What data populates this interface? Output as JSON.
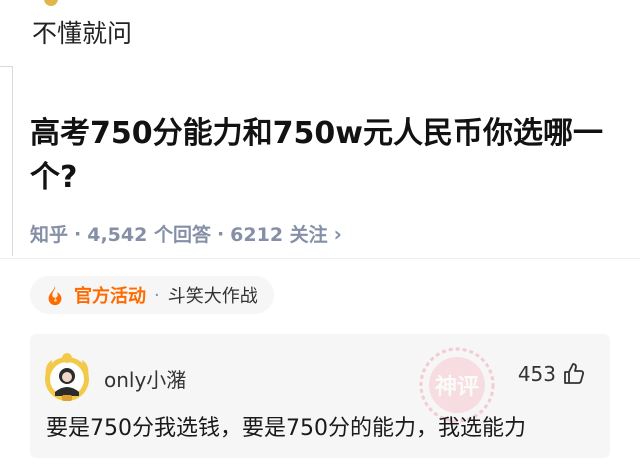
{
  "top_post": {
    "text": "不懂就问"
  },
  "question": {
    "title": "高考750分能力和750w元人民币你选哪一个?",
    "source": "知乎",
    "answers": "4,542 个回答",
    "follows": "6212 关注",
    "sep": "·"
  },
  "activity": {
    "label": "官方活动",
    "sep": "·",
    "name": "斗笑大作战"
  },
  "comment": {
    "username": "only小潴",
    "likes": "453",
    "text": "要是750分我选钱，要是750分的能力，我选能力",
    "stamp_text": "神评"
  },
  "colors": {
    "accent_orange": "#ff6a00",
    "meta_gray": "#8590a6",
    "stamp_red": "#f2a8b6",
    "badge_gold": "#e0b64a"
  },
  "icons": [
    "fire-icon",
    "chevron-right-icon",
    "thumbs-up-icon",
    "avatar-badge-icon"
  ]
}
